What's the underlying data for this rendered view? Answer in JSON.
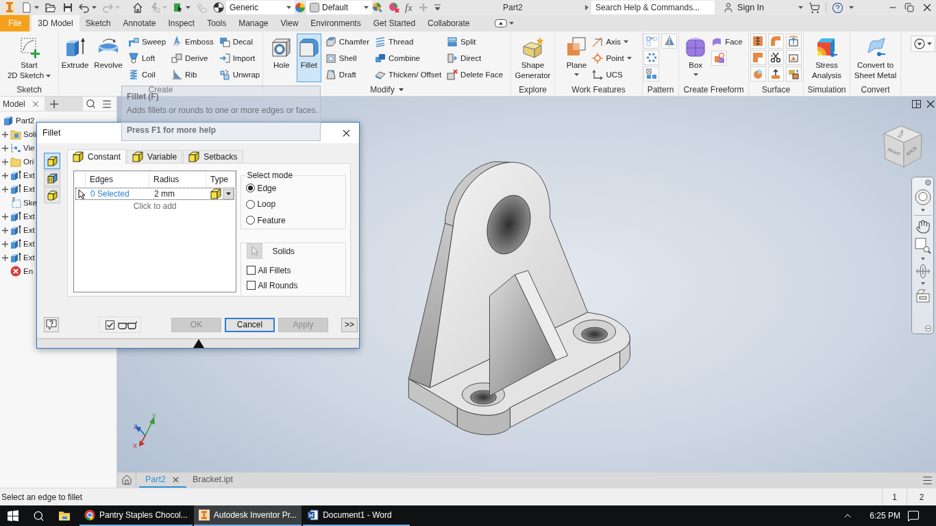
{
  "window": {
    "title": "Part2",
    "search": {
      "placeholder": "Search Help & Commands..."
    },
    "account": "Sign In"
  },
  "quick_access": {
    "tools": [
      {
        "disabled": false
      },
      {
        "disabled": false
      },
      {
        "disabled": false
      },
      {
        "disabled": false
      },
      {
        "disabled": true
      },
      {
        "disabled": false
      },
      {
        "disabled": true
      },
      {
        "disabled": false
      },
      {
        "disabled": true
      },
      {
        "disabled": false
      }
    ],
    "material": "Generic",
    "appearance": "Default",
    "extra_tools": [
      {
        "disabled": false
      },
      {
        "disabled": false
      },
      {
        "text": "fx",
        "disabled": false
      },
      {
        "disabled": true
      }
    ]
  },
  "tabs": [
    {
      "label": "File",
      "kind": "file",
      "selected": false
    },
    {
      "label": "3D Model",
      "kind": "tab",
      "selected": true
    },
    {
      "label": "Sketch",
      "kind": "tab",
      "selected": false
    },
    {
      "label": "Annotate",
      "kind": "tab",
      "selected": false
    },
    {
      "label": "Inspect",
      "kind": "tab",
      "selected": false
    },
    {
      "label": "Tools",
      "kind": "tab",
      "selected": false
    },
    {
      "label": "Manage",
      "kind": "tab",
      "selected": false
    },
    {
      "label": "View",
      "kind": "tab",
      "selected": false
    },
    {
      "label": "Environments",
      "kind": "tab",
      "selected": false
    },
    {
      "label": "Get Started",
      "kind": "tab",
      "selected": false
    },
    {
      "label": "Collaborate",
      "kind": "tab",
      "selected": false
    }
  ],
  "ribbon": {
    "panels": [
      {
        "title": "Sketch",
        "menu": false,
        "groups": [
          {
            "kind": "large",
            "tools": [
              {
                "lines": [
                  "Start",
                  "2D Sketch"
                ],
                "active": false,
                "dropdown": true
              }
            ]
          }
        ]
      },
      {
        "title": "Create",
        "menu": false,
        "groups": [
          {
            "kind": "large",
            "tools": [
              {
                "lines": [
                  "Extrude"
                ],
                "active": false
              },
              {
                "lines": [
                  "Revolve"
                ],
                "active": false
              }
            ]
          },
          {
            "kind": "small",
            "tools": [
              {
                "label": "Sweep"
              },
              {
                "label": "Loft"
              },
              {
                "label": "Coil"
              }
            ]
          },
          {
            "kind": "small",
            "tools": [
              {
                "label": "Emboss"
              },
              {
                "label": "Derive"
              },
              {
                "label": "Rib"
              }
            ]
          },
          {
            "kind": "small",
            "tools": [
              {
                "label": "Decal"
              },
              {
                "label": "Import"
              },
              {
                "label": "Unwrap"
              }
            ]
          }
        ]
      },
      {
        "title": "Modify",
        "menu": true,
        "groups": [
          {
            "kind": "large",
            "tools": [
              {
                "lines": [
                  "Hole"
                ],
                "active": false
              },
              {
                "lines": [
                  "Fillet"
                ],
                "active": true
              }
            ]
          },
          {
            "kind": "small",
            "tools": [
              {
                "label": "Chamfer"
              },
              {
                "label": "Shell"
              },
              {
                "label": "Draft"
              }
            ]
          },
          {
            "kind": "small",
            "tools": [
              {
                "label": "Thread"
              },
              {
                "label": "Combine"
              },
              {
                "label": "Thicken/ Offset"
              }
            ]
          },
          {
            "kind": "small",
            "tools": [
              {
                "label": "Split"
              },
              {
                "label": "Direct"
              },
              {
                "label": "Delete Face"
              }
            ]
          }
        ]
      },
      {
        "title": "Explore",
        "menu": false,
        "groups": [
          {
            "kind": "large",
            "tools": [
              {
                "lines": [
                  "Shape",
                  "Generator"
                ],
                "active": false
              }
            ]
          }
        ]
      },
      {
        "title": "Work Features",
        "menu": false,
        "groups": [
          {
            "kind": "large",
            "tools": [
              {
                "lines": [
                  "Plane"
                ],
                "active": false,
                "dropdown": true
              }
            ]
          },
          {
            "kind": "small",
            "tools": [
              {
                "label": "Axis",
                "dropdown": true
              },
              {
                "label": "Point",
                "dropdown": true
              },
              {
                "label": "UCS",
                "dropdown": false
              }
            ]
          }
        ]
      },
      {
        "title": "Pattern",
        "menu": false,
        "groups": [
          {
            "kind": "icon_grid"
          }
        ]
      },
      {
        "title": "Create Freeform",
        "menu": false,
        "groups": [
          {
            "kind": "large",
            "tools": [
              {
                "lines": [
                  "Box"
                ],
                "active": false,
                "dropdown": true
              }
            ]
          },
          {
            "kind": "small",
            "tools": [
              {
                "kind": "labeled",
                "label": "Face"
              },
              {
                "kind": "icon"
              }
            ]
          }
        ]
      },
      {
        "title": "Surface",
        "menu": false,
        "groups": [
          {
            "kind": "icon_grid"
          }
        ]
      },
      {
        "title": "Simulation",
        "menu": false,
        "groups": [
          {
            "kind": "large",
            "tools": [
              {
                "lines": [
                  "Stress",
                  "Analysis"
                ],
                "active": false
              }
            ]
          }
        ]
      },
      {
        "title": "Convert",
        "menu": false,
        "groups": [
          {
            "kind": "large",
            "tools": [
              {
                "lines": [
                  "Convert to",
                  "Sheet Metal"
                ],
                "active": false
              }
            ]
          }
        ]
      }
    ]
  },
  "tooltip": {
    "title": "Fillet (F)",
    "description": "Adds fillets or rounds to one or more edges or faces.",
    "footer": "Press F1 for more help"
  },
  "browser": {
    "title": "Model",
    "tree": [
      {
        "label": "Part2",
        "kind": "part",
        "children": [
          {
            "label": "Soli",
            "kind": "solids",
            "expandable": true
          },
          {
            "label": "Vie",
            "kind": "view",
            "expandable": true
          },
          {
            "label": "Ori",
            "kind": "origin",
            "expandable": true
          },
          {
            "label": "Ext",
            "kind": "extrusion",
            "expandable": true
          },
          {
            "label": "Ext",
            "kind": "extrusion",
            "expandable": true
          },
          {
            "label": "Ske",
            "kind": "sketch",
            "expandable": false
          },
          {
            "label": "Ext",
            "kind": "extrusion",
            "expandable": true
          },
          {
            "label": "Ext",
            "kind": "extrusion",
            "expandable": true
          },
          {
            "label": "Ext",
            "kind": "extrusion",
            "expandable": true
          },
          {
            "label": "Ext",
            "kind": "extrusion",
            "expandable": true
          },
          {
            "label": "En",
            "kind": "end",
            "expandable": false
          }
        ]
      }
    ]
  },
  "fillet_dialog": {
    "title": "Fillet",
    "modes": [
      {
        "selected": true
      },
      {
        "selected": false
      },
      {
        "selected": false
      }
    ],
    "tabs": [
      {
        "label": "Constant",
        "selected": true
      },
      {
        "label": "Variable",
        "selected": false
      },
      {
        "label": "Setbacks",
        "selected": false
      }
    ],
    "table": {
      "columns": [
        "Edges",
        "Radius",
        "Type"
      ],
      "rows": [
        {
          "edges": "0 Selected",
          "radius": "2 mm",
          "focused": true
        }
      ],
      "add_hint": "Click to add"
    },
    "select_mode": {
      "title": "Select mode",
      "options": [
        {
          "label": "Edge",
          "selected": true
        },
        {
          "label": "Loop",
          "selected": false
        },
        {
          "label": "Feature",
          "selected": false
        }
      ]
    },
    "solids": {
      "label": "Solids",
      "options": [
        {
          "label": "All Fillets",
          "checked": false
        },
        {
          "label": "All Rounds",
          "checked": false
        }
      ]
    },
    "preview": {
      "checked": true
    },
    "buttons": [
      {
        "label": "OK",
        "disabled": true,
        "focused": false
      },
      {
        "label": "Cancel",
        "disabled": false,
        "focused": true
      },
      {
        "label": "Apply",
        "disabled": true,
        "focused": false
      }
    ],
    "more": ">>"
  },
  "viewport": {
    "viewcube": {
      "faces": [
        "TOP",
        "RIGHT",
        "BACK"
      ]
    },
    "axes": [
      {
        "label": "Y",
        "color": "#3a9a3a"
      },
      {
        "label": "Z",
        "color": "#2a5cb8"
      },
      {
        "label": "X",
        "color": "#c0302a"
      }
    ]
  },
  "document_tabs": [
    {
      "label": "Part2",
      "selected": true,
      "closable": true
    },
    {
      "label": "Bracket.ipt",
      "selected": false,
      "closable": false
    }
  ],
  "status_bar": {
    "prompt": "Select an edge to fillet",
    "cells": [
      "1",
      "2"
    ]
  },
  "taskbar": {
    "apps": [
      {
        "label": "Pantry Staples Chocol...",
        "kind": "browser",
        "active": false
      },
      {
        "label": "Autodesk Inventor Pr...",
        "kind": "inventor",
        "active": true
      },
      {
        "label": "Document1 - Word",
        "kind": "word",
        "active": false
      }
    ],
    "clock": "6:25 PM"
  }
}
